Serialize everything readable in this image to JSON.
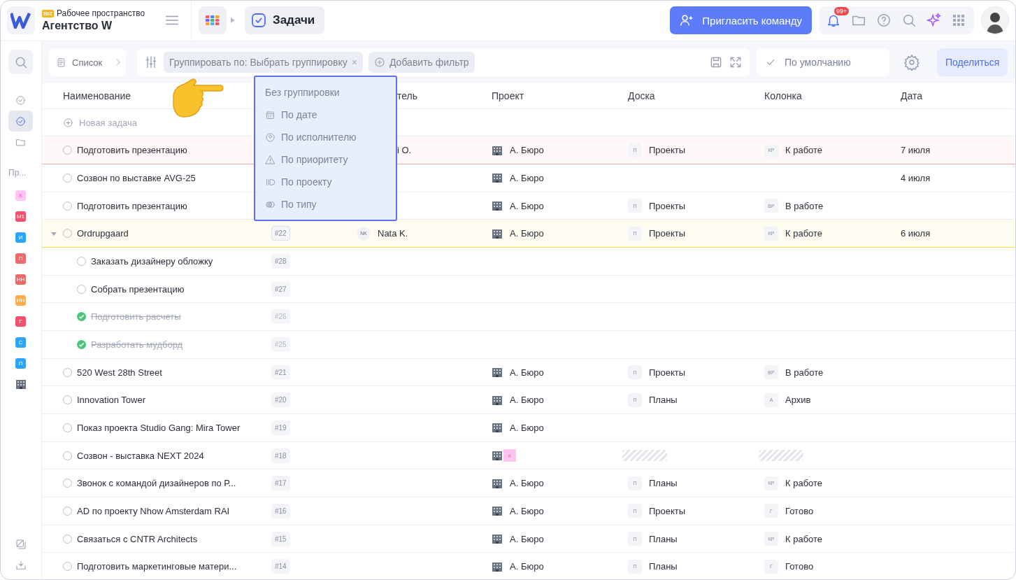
{
  "workspace": {
    "badge": "BIZ",
    "caption": "Рабочее пространство",
    "name": "Агентство W"
  },
  "breadcrumb": {
    "current": "Задачи"
  },
  "invite_button": "Пригласить команду",
  "notifications": {
    "count": "99+"
  },
  "toolbar": {
    "view": "Список",
    "group_chip": "Группировать по: Выбрать группировку",
    "chip_close": "×",
    "add_filter": "Добавить фильтр",
    "preset": "По умолчанию",
    "share": "Поделиться"
  },
  "sidebar": {
    "items": [
      {
        "kind": "done",
        "selected": false
      },
      {
        "kind": "done",
        "selected": true
      },
      {
        "kind": "folder",
        "selected": false
      }
    ],
    "section": "Пр...",
    "projects": [
      {
        "label": "К",
        "color": "#ffc4ef"
      },
      {
        "label": "М1",
        "color": "#f5516f"
      },
      {
        "label": "И",
        "color": "#2fa4fb"
      },
      {
        "label": "П",
        "color": "#ee6b6b"
      },
      {
        "label": "НН",
        "color": "#ea6a6a"
      },
      {
        "label": "НН",
        "color": "#ffac4a"
      },
      {
        "label": "Г",
        "color": "#f5516f"
      },
      {
        "label": "С",
        "color": "#2fa4fb"
      },
      {
        "label": "П",
        "color": "#2fa4fb"
      }
    ]
  },
  "table": {
    "columns": [
      {
        "label": "Наименование",
        "covered": false
      },
      {
        "label": "тель",
        "covered": true
      },
      {
        "label": "Проект",
        "covered": false
      },
      {
        "label": "Доска",
        "covered": false
      },
      {
        "label": "Колонка",
        "covered": false
      },
      {
        "label": "Дата",
        "covered": false
      }
    ],
    "new_task": "Новая задача",
    "rows": [
      {
        "name": "Подготовить презентацию",
        "done": false,
        "assignee": {
          "text": "i O.",
          "covered": true
        },
        "project": {
          "kind": "label",
          "text": "А. Бюро"
        },
        "board": {
          "kind": "tag",
          "tag": "П",
          "text": "Проекты"
        },
        "column": {
          "kind": "tag",
          "tag": "КР",
          "text": "К работе"
        },
        "date": "7 июля",
        "color": "#f5a3a3"
      },
      {
        "name": "Созвон по выставке AVG-25",
        "done": false,
        "project": {
          "kind": "label",
          "text": "А. Бюро"
        },
        "date": "4 июля"
      },
      {
        "name": "Подготовить презентацию",
        "done": false,
        "project": {
          "kind": "label",
          "text": "А. Бюро"
        },
        "board": {
          "kind": "tag",
          "tag": "П",
          "text": "Проекты"
        },
        "column": {
          "kind": "tag",
          "tag": "ВР",
          "text": "В работе"
        }
      },
      {
        "name": "Ordrupgaard",
        "done": false,
        "id": "#22",
        "expanded": true,
        "assignee": {
          "initials": "NK",
          "text": "Nata K."
        },
        "project": {
          "kind": "label",
          "text": "А. Бюро"
        },
        "board": {
          "kind": "tag",
          "tag": "П",
          "text": "Проекты"
        },
        "column": {
          "kind": "tag",
          "tag": "КР",
          "text": "К работе"
        },
        "date": "6 июля",
        "color": "#f7dc4a",
        "children": [
          {
            "name": "Заказать дизайнеру обложку",
            "done": false,
            "id": "#28"
          },
          {
            "name": "Собрать презентацию",
            "done": false,
            "id": "#27"
          },
          {
            "name": "Подготовить расчеты",
            "done": true,
            "id": "#26"
          },
          {
            "name": "Разработать мудборд",
            "done": true,
            "id": "#25"
          }
        ]
      },
      {
        "name": "520 West 28th Street",
        "done": false,
        "id": "#21",
        "project": {
          "kind": "label",
          "text": "А. Бюро"
        },
        "board": {
          "kind": "tag",
          "tag": "П",
          "text": "Проекты"
        },
        "column": {
          "kind": "tag",
          "tag": "ВР",
          "text": "В работе"
        }
      },
      {
        "name": "Innovation Tower",
        "done": false,
        "id": "#20",
        "project": {
          "kind": "label",
          "text": "А. Бюро"
        },
        "board": {
          "kind": "tag",
          "tag": "П",
          "text": "Планы"
        },
        "column": {
          "kind": "tag",
          "tag": "А",
          "text": "Архив"
        }
      },
      {
        "name": "Показ проекта Studio Gang: Mira Tower",
        "done": false,
        "id": "#19",
        "project": {
          "kind": "label",
          "text": "А. Бюро"
        }
      },
      {
        "name": "Созвон - выставка NEXT 2024",
        "done": false,
        "id": "#18",
        "project": {
          "kind": "badge",
          "text": "К"
        },
        "board": {
          "kind": "loading"
        },
        "column": {
          "kind": "loading"
        }
      },
      {
        "name": "Звонок с командой дизайнеров по Р...",
        "done": false,
        "id": "#17",
        "project": {
          "kind": "label",
          "text": "А. Бюро"
        },
        "board": {
          "kind": "tag",
          "tag": "П",
          "text": "Планы"
        },
        "column": {
          "kind": "tag",
          "tag": "КР",
          "text": "К работе"
        }
      },
      {
        "name": "AD по проекту Nhow Amsterdam RAI",
        "done": false,
        "id": "#16",
        "project": {
          "kind": "label",
          "text": "А. Бюро"
        },
        "board": {
          "kind": "tag",
          "tag": "П",
          "text": "Проекты"
        },
        "column": {
          "kind": "tag",
          "tag": "Г",
          "text": "Готово"
        }
      },
      {
        "name": "Связаться с CNTR Architects",
        "done": false,
        "id": "#15",
        "project": {
          "kind": "label",
          "text": "А. Бюро"
        },
        "board": {
          "kind": "tag",
          "tag": "П",
          "text": "Планы"
        },
        "column": {
          "kind": "tag",
          "tag": "КР",
          "text": "К работе"
        }
      },
      {
        "name": "Подготовить маркетинговые матери...",
        "done": false,
        "id": "#14",
        "project": {
          "kind": "label",
          "text": "А. Бюро"
        },
        "board": {
          "kind": "tag",
          "tag": "П",
          "text": "Планы"
        },
        "column": {
          "kind": "tag",
          "tag": "Г",
          "text": "Готово"
        }
      }
    ]
  },
  "group_menu": {
    "items": [
      {
        "kind": "none",
        "label": "Без группировки"
      },
      {
        "kind": "date",
        "label": "По дате"
      },
      {
        "kind": "person",
        "label": "По исполнителю"
      },
      {
        "kind": "priority",
        "label": "По приоритету"
      },
      {
        "kind": "project",
        "label": "По проекту"
      },
      {
        "kind": "type",
        "label": "По типу"
      }
    ]
  }
}
